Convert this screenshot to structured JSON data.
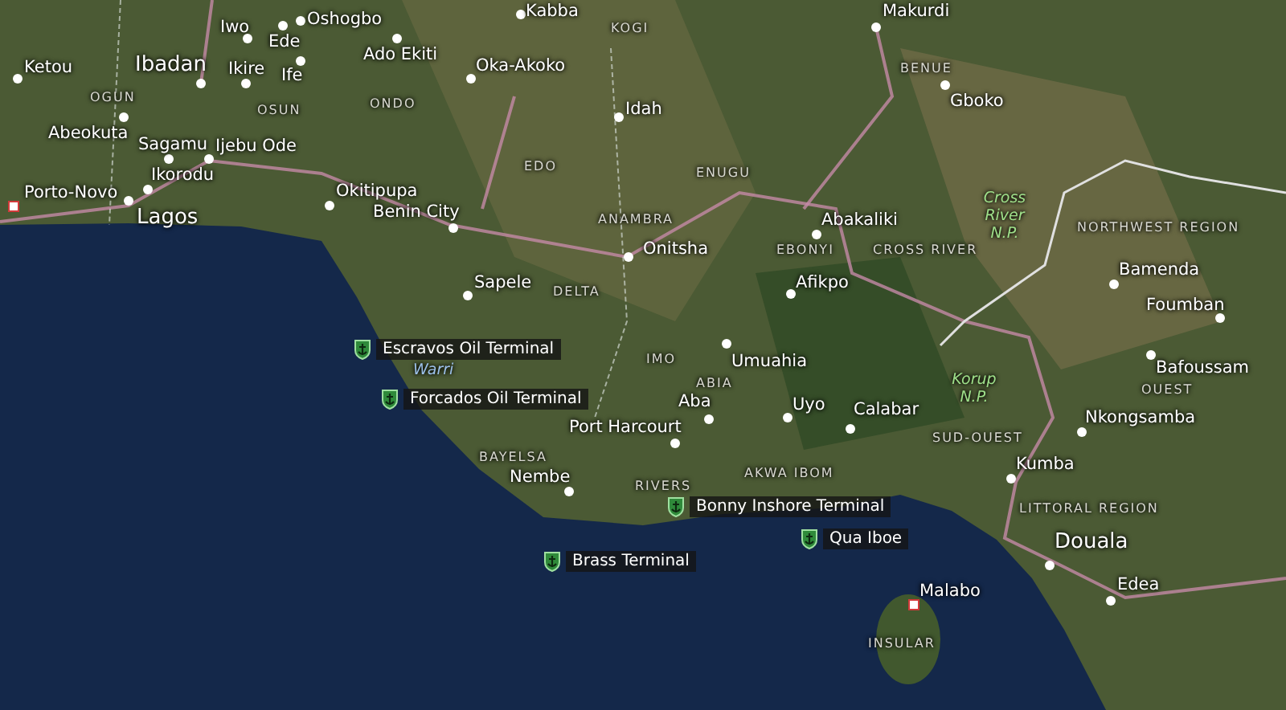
{
  "map": {
    "labels": [
      {
        "kind": "city",
        "text": "Kabba"
      },
      {
        "kind": "city",
        "text": "Makurdi"
      },
      {
        "kind": "city",
        "text": "Iwo"
      },
      {
        "kind": "city",
        "text": "Oshogbo"
      },
      {
        "kind": "region",
        "text": "KOGI"
      },
      {
        "kind": "city",
        "text": "Ede"
      },
      {
        "kind": "city",
        "text": "Ketou"
      },
      {
        "kind": "city",
        "text": "Ibadan"
      },
      {
        "kind": "city",
        "text": "Ikire"
      },
      {
        "kind": "city",
        "text": "Ife"
      },
      {
        "kind": "city",
        "text": "Ado Ekiti"
      },
      {
        "kind": "city",
        "text": "Oka-Akoko"
      },
      {
        "kind": "region",
        "text": "BENUE"
      },
      {
        "kind": "region",
        "text": "OGUN"
      },
      {
        "kind": "region",
        "text": "OSUN"
      },
      {
        "kind": "region",
        "text": "ONDO"
      },
      {
        "kind": "city",
        "text": "Idah"
      },
      {
        "kind": "city",
        "text": "Gboko"
      },
      {
        "kind": "city",
        "text": "Abeokuta"
      },
      {
        "kind": "city",
        "text": "Sagamu"
      },
      {
        "kind": "city",
        "text": "Ijebu Ode"
      },
      {
        "kind": "region",
        "text": "EDO"
      },
      {
        "kind": "region",
        "text": "ENUGU"
      },
      {
        "kind": "city",
        "text": "Ikorodu"
      },
      {
        "kind": "capital",
        "text": "Porto-Novo"
      },
      {
        "kind": "city",
        "text": "Okitipupa"
      },
      {
        "kind": "city",
        "text": "Lagos"
      },
      {
        "kind": "city",
        "text": "Benin City"
      },
      {
        "kind": "region",
        "text": "ANAMBRA"
      },
      {
        "kind": "city",
        "text": "Abakaliki"
      },
      {
        "kind": "park",
        "text": "Cross River N.P."
      },
      {
        "kind": "region",
        "text": "NORTHWEST REGION"
      },
      {
        "kind": "city",
        "text": "Onitsha"
      },
      {
        "kind": "region",
        "text": "EBONYI"
      },
      {
        "kind": "region",
        "text": "CROSS RIVER"
      },
      {
        "kind": "city",
        "text": "Bamenda"
      },
      {
        "kind": "city",
        "text": "Sapele"
      },
      {
        "kind": "region",
        "text": "DELTA"
      },
      {
        "kind": "city",
        "text": "Afikpo"
      },
      {
        "kind": "city",
        "text": "Foumban"
      },
      {
        "kind": "terminal",
        "text": "Escravos Oil Terminal"
      },
      {
        "kind": "water",
        "text": "Warri"
      },
      {
        "kind": "region",
        "text": "IMO"
      },
      {
        "kind": "city",
        "text": "Umuahia"
      },
      {
        "kind": "city",
        "text": "Bafoussam"
      },
      {
        "kind": "region",
        "text": "ABIA"
      },
      {
        "kind": "park",
        "text": "Korup N.P."
      },
      {
        "kind": "region",
        "text": "OUEST"
      },
      {
        "kind": "terminal",
        "text": "Forcados Oil Terminal"
      },
      {
        "kind": "city",
        "text": "Aba"
      },
      {
        "kind": "city",
        "text": "Uyo"
      },
      {
        "kind": "city",
        "text": "Calabar"
      },
      {
        "kind": "city",
        "text": "Nkongsamba"
      },
      {
        "kind": "city",
        "text": "Port Harcourt"
      },
      {
        "kind": "region",
        "text": "SUD-OUEST"
      },
      {
        "kind": "region",
        "text": "BAYELSA"
      },
      {
        "kind": "city",
        "text": "Kumba"
      },
      {
        "kind": "region",
        "text": "AKWA IBOM"
      },
      {
        "kind": "city",
        "text": "Nembe"
      },
      {
        "kind": "region",
        "text": "RIVERS"
      },
      {
        "kind": "terminal",
        "text": "Bonny Inshore Terminal"
      },
      {
        "kind": "region",
        "text": "LITTORAL REGION"
      },
      {
        "kind": "terminal",
        "text": "Qua Iboe"
      },
      {
        "kind": "city",
        "text": "Douala"
      },
      {
        "kind": "terminal",
        "text": "Brass Terminal"
      },
      {
        "kind": "city",
        "text": "Edea"
      },
      {
        "kind": "capital",
        "text": "Malabo"
      },
      {
        "kind": "region",
        "text": "INSULAR"
      }
    ]
  }
}
